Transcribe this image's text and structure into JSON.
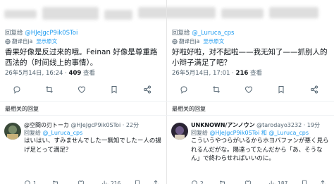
{
  "left": {
    "reply_prefix": "回复给",
    "reply_handle": "@HJeJgcP9ik0SToi",
    "translate_text": "翻译自ja",
    "translate_link": "显示原文",
    "text": "香果好像是反过来的哦。Feinan 好像是尊重路西法的（时间线上的事情）。",
    "timestamp": "26年5月14日, 16:24 · ",
    "views": "409",
    "views_label": " 查看",
    "sort_label": "最相关的回复",
    "reply": {
      "name": "@空間の刃トーカ",
      "handle": " @HJeJgcP9ik0SToi · 22分",
      "reply_prefix": "回复给 ",
      "reply_handle": "@_Luruca_cps",
      "text": "はいはい、すみませんでした一無知でしたー人の揚げ足とって満足？",
      "reply_count": "1",
      "views": "216"
    }
  },
  "right": {
    "reply_prefix": "回复给",
    "reply_handle": "@_Luruca_cps",
    "translate_text": "翻译自ja",
    "translate_link": "显示原文",
    "text": "好啦好啦，对不起啦——我无知了——抓别人的小辫子满足了吧？",
    "timestamp": "26年5月14日, 17:01 · ",
    "views": "216",
    "views_label": " 查看",
    "sort_label": "最相关的回复",
    "reply": {
      "name": "UNKNOWN/アンノウン",
      "handle": " @tarodayo3232 · 19分",
      "reply_prefix": "回复给 ",
      "reply_handle": "@HJeJgcP9ik0SToi 和 @_Luruca_cps",
      "text": "こういうやつらがいるからホヨバファンが悪く見られるんだがな。陽達ってたんだから「あ、そうなん」で終わらせればいいのに。",
      "reply_count": "2",
      "views": "187"
    }
  },
  "icons": [
    "globe-icon",
    "reply-icon",
    "retweet-icon",
    "like-icon",
    "bookmark-icon",
    "share-icon",
    "views-icon"
  ],
  "colors": {
    "accent": "#1d9bf0",
    "muted": "#536471",
    "text": "#0f1419"
  }
}
